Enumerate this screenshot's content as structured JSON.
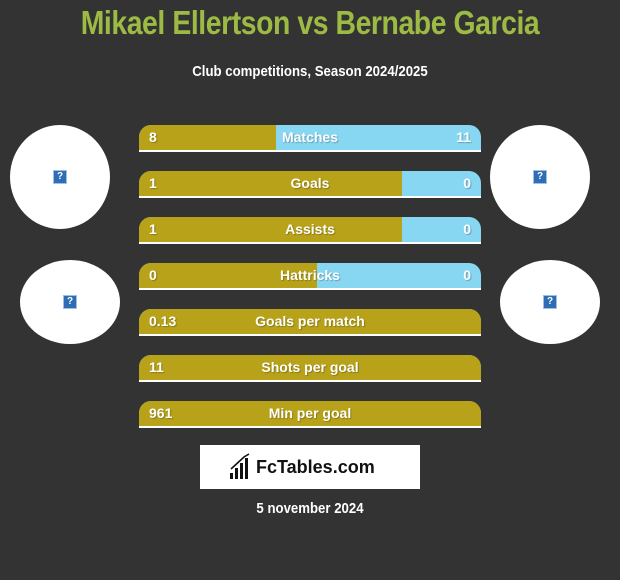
{
  "header": {
    "title": "Mikael Ellertson vs Bernabe Garcia",
    "subtitle": "Club competitions, Season 2024/2025"
  },
  "players": {
    "left": {
      "name": "Mikael Ellertson",
      "avatar_icon": "missing-image-icon",
      "club_icon": "missing-image-icon"
    },
    "right": {
      "name": "Bernabe Garcia",
      "avatar_icon": "missing-image-icon",
      "club_icon": "missing-image-icon"
    }
  },
  "colors": {
    "left": "#b8a21a",
    "right": "#87d7f2",
    "title": "#9dbb44",
    "background": "#333333"
  },
  "stats": [
    {
      "label": "Matches",
      "left": "8",
      "right": "11",
      "left_share": 0.4
    },
    {
      "label": "Goals",
      "left": "1",
      "right": "0",
      "left_share": 0.77
    },
    {
      "label": "Assists",
      "left": "1",
      "right": "0",
      "left_share": 0.77
    },
    {
      "label": "Hattricks",
      "left": "0",
      "right": "0",
      "left_share": 0.52
    },
    {
      "label": "Goals per match",
      "left": "0.13",
      "right": "",
      "left_share": 1.0
    },
    {
      "label": "Shots per goal",
      "left": "11",
      "right": "",
      "left_share": 1.0
    },
    {
      "label": "Min per goal",
      "left": "961",
      "right": "",
      "left_share": 1.0
    }
  ],
  "footer": {
    "logo_text": "FcTables.com",
    "logo_icon": "bar-chart-icon",
    "date": "5 november 2024"
  }
}
